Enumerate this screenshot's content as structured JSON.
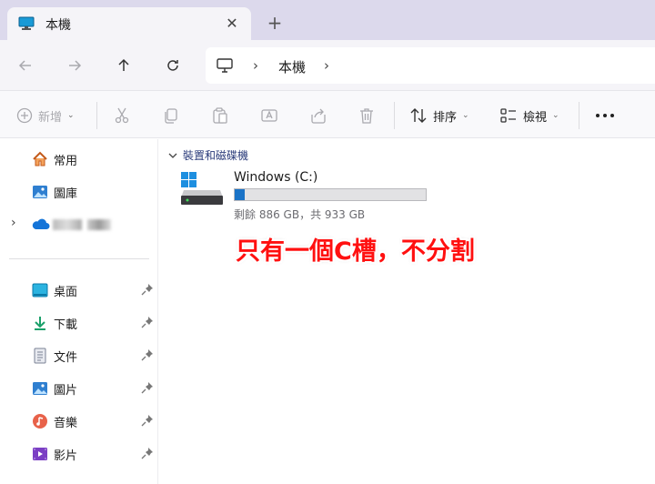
{
  "tab": {
    "title": "本機",
    "close_icon": "close-icon",
    "new_tab_icon": "plus-icon"
  },
  "nav": {
    "back_icon": "arrow-left-icon",
    "forward_icon": "arrow-right-icon",
    "up_icon": "arrow-up-icon",
    "refresh_icon": "refresh-icon"
  },
  "address": {
    "location_icon": "computer-icon",
    "crumb": "本機"
  },
  "toolbar": {
    "new_label": "新增",
    "sort_label": "排序",
    "view_label": "檢視",
    "more_icon": "more-icon"
  },
  "sidebar": {
    "home": "常用",
    "gallery": "圖庫",
    "desktop": "桌面",
    "downloads": "下載",
    "documents": "文件",
    "pictures": "圖片",
    "music": "音樂",
    "videos": "影片"
  },
  "main": {
    "group_title": "裝置和磁碟機",
    "drive": {
      "name": "Windows (C:)",
      "space": "剩餘 886 GB，共 933 GB",
      "used_fraction": 0.05
    },
    "annotation": "只有一個C槽，不分割"
  },
  "colors": {
    "accent": "#1a73c7",
    "annotation": "#ff1010",
    "tabstrip": "#dcd9ec"
  }
}
